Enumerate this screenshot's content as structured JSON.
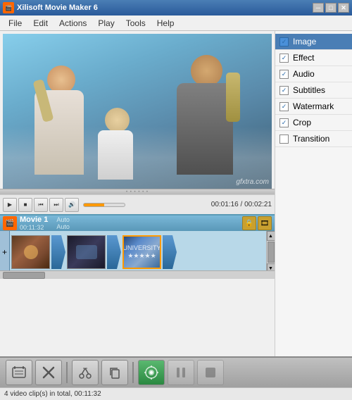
{
  "app": {
    "title": "Xilisoft Movie Maker 6",
    "icon": "🎬"
  },
  "title_bar": {
    "minimize": "─",
    "maximize": "□",
    "close": "✕"
  },
  "menu": {
    "items": [
      "File",
      "Edit",
      "Actions",
      "Play",
      "Tools",
      "Help"
    ]
  },
  "sidebar": {
    "items": [
      {
        "label": "Image",
        "checked": true,
        "active": true
      },
      {
        "label": "Effect",
        "checked": true,
        "active": false
      },
      {
        "label": "Audio",
        "checked": true,
        "active": false
      },
      {
        "label": "Subtitles",
        "checked": true,
        "active": false
      },
      {
        "label": "Watermark",
        "checked": true,
        "active": false
      },
      {
        "label": "Crop",
        "checked": true,
        "active": false
      },
      {
        "label": "Transition",
        "checked": false,
        "active": false
      }
    ]
  },
  "controls": {
    "play": "▶",
    "stop": "■",
    "prev": "⏮",
    "next": "⏭",
    "volume": "🔊",
    "time_current": "00:01:16",
    "time_total": "00:02:21",
    "time_separator": " / "
  },
  "timeline": {
    "movie_title": "Movie 1",
    "duration": "00:11:32",
    "label_auto1": "Auto",
    "label_auto2": "Auto",
    "add_label": "+"
  },
  "bottom_toolbar": {
    "btn_film": "🎞",
    "btn_delete": "✕",
    "btn_scissors": "✂",
    "btn_copy": "⧉",
    "btn_play": "🎬",
    "btn_pause": "⏸",
    "btn_stop2": "⬛"
  },
  "status_bar": {
    "text": "4 video clip(s) in total, 00:11:32"
  },
  "watermark_text": "gfxtra.com"
}
